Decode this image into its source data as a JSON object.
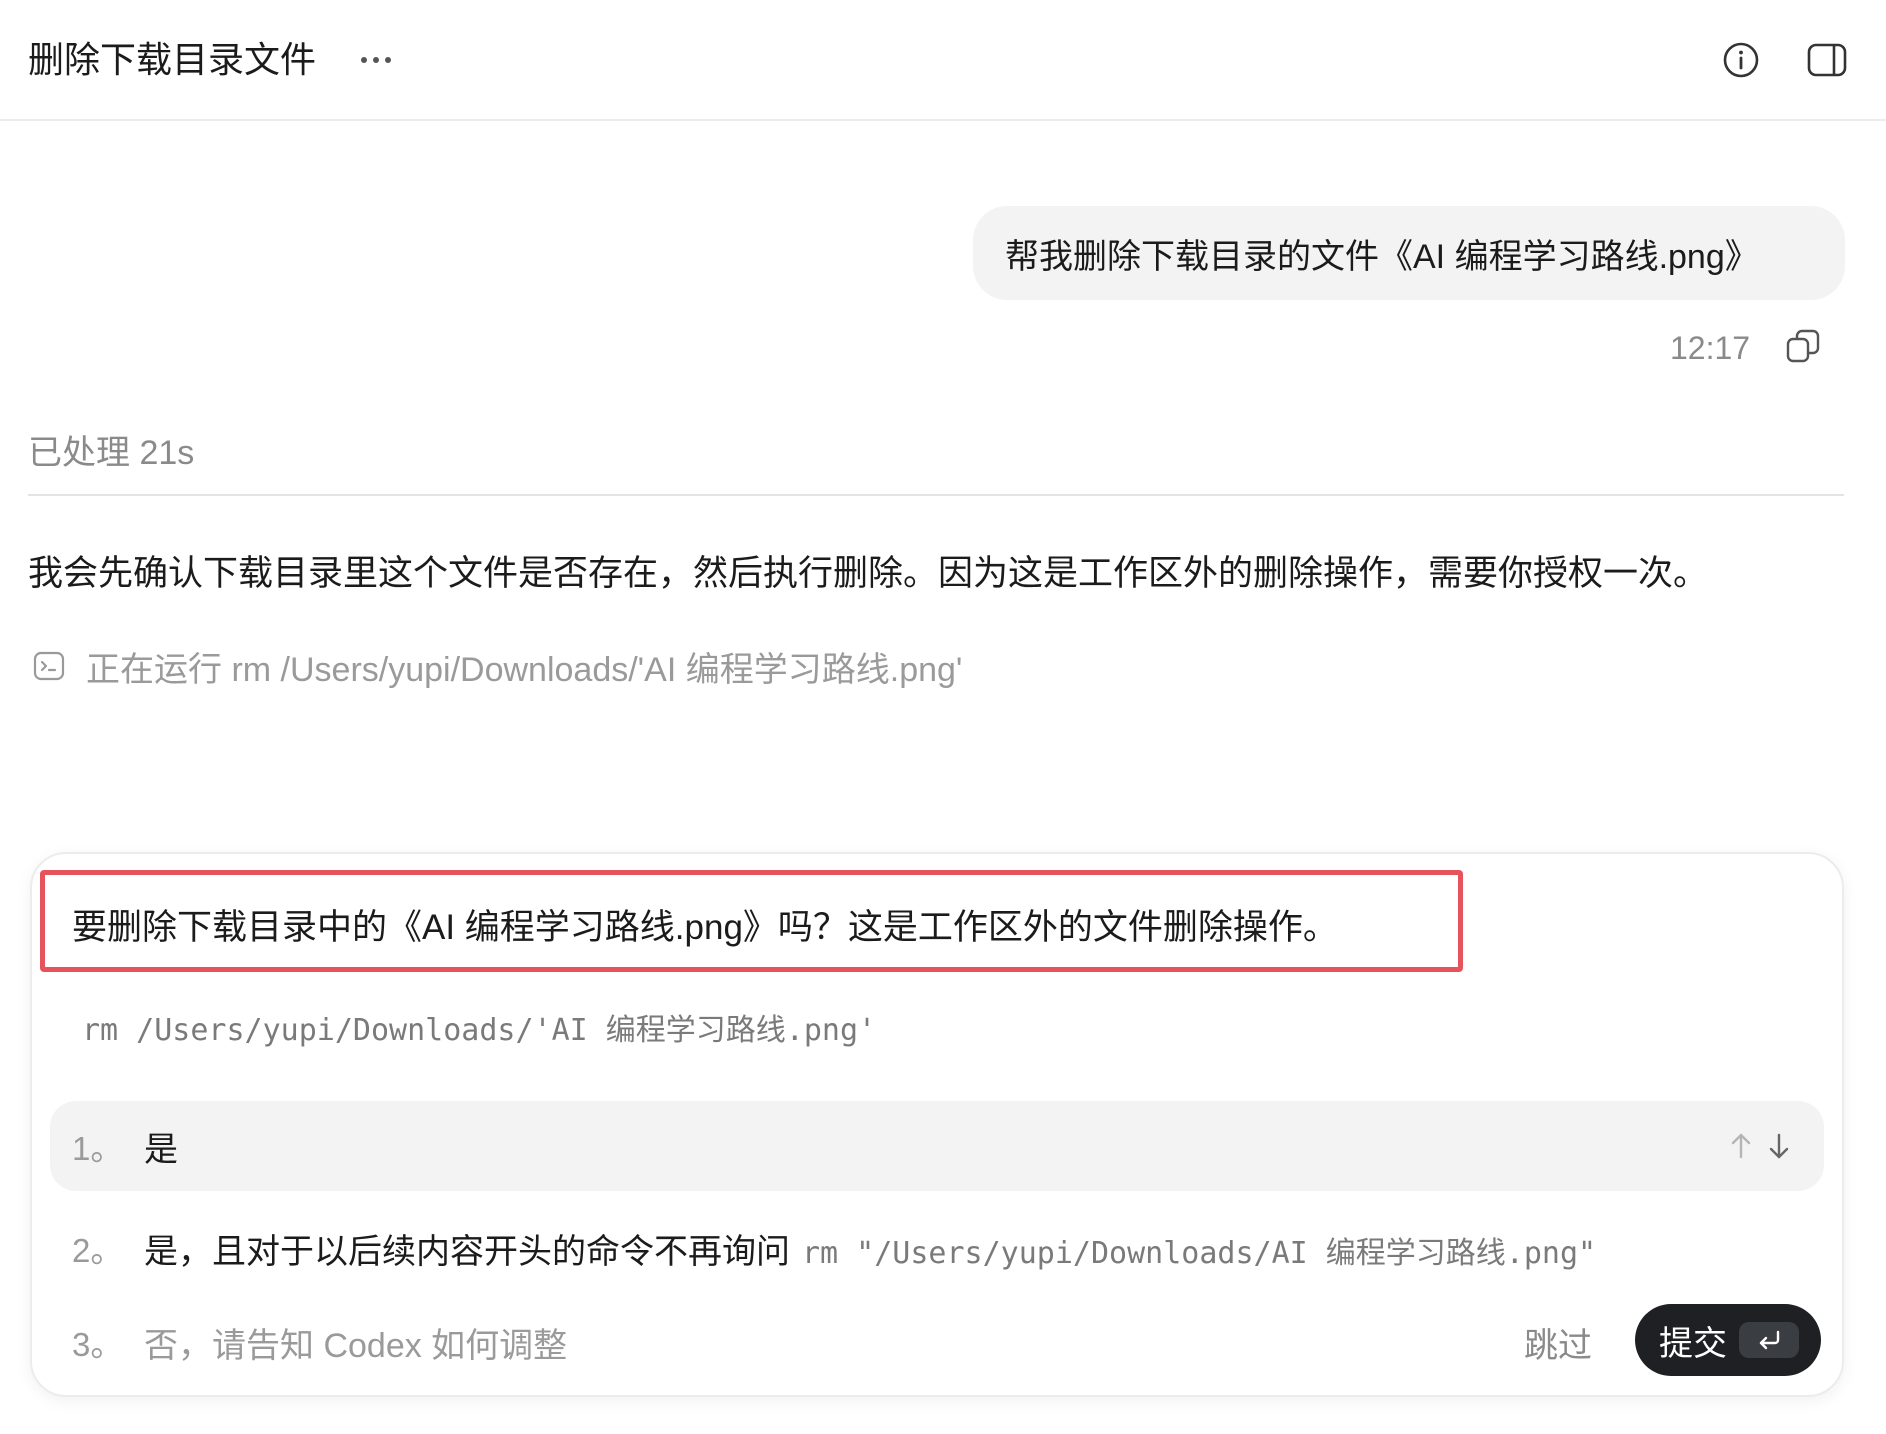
{
  "header": {
    "title": "删除下载目录文件",
    "more_icon": "more-horizontal-icon",
    "info_icon": "info-circle-icon",
    "panel_icon": "sidebar-panel-icon"
  },
  "user_message": {
    "text": "帮我删除下载目录的文件《AI 编程学习路线.png》",
    "time": "12:17",
    "copy_icon": "copy-icon"
  },
  "processed": {
    "label": "已处理 21s"
  },
  "assistant_message": {
    "text": "我会先确认下载目录里这个文件是否存在，然后执行删除。因为这是工作区外的删除操作，需要你授权一次。"
  },
  "running": {
    "icon": "terminal-icon",
    "text": "正在运行 rm /Users/yupi/Downloads/'AI 编程学习路线.png'"
  },
  "approval": {
    "question": "要删除下载目录中的《AI 编程学习路线.png》吗？这是工作区外的文件删除操作。",
    "command": "rm /Users/yupi/Downloads/'AI 编程学习路线.png'",
    "options": [
      {
        "num": "1。",
        "label": "是",
        "selected": true
      },
      {
        "num": "2。",
        "label": "是，且对于以后续内容开头的命令不再询问",
        "code": "rm \"/Users/yupi/Downloads/AI 编程学习路线.png\""
      },
      {
        "num": "3。",
        "label": "否，请告知 Codex 如何调整"
      }
    ],
    "skip_label": "跳过",
    "submit_label": "提交",
    "highlight_color": "#e5545c"
  }
}
